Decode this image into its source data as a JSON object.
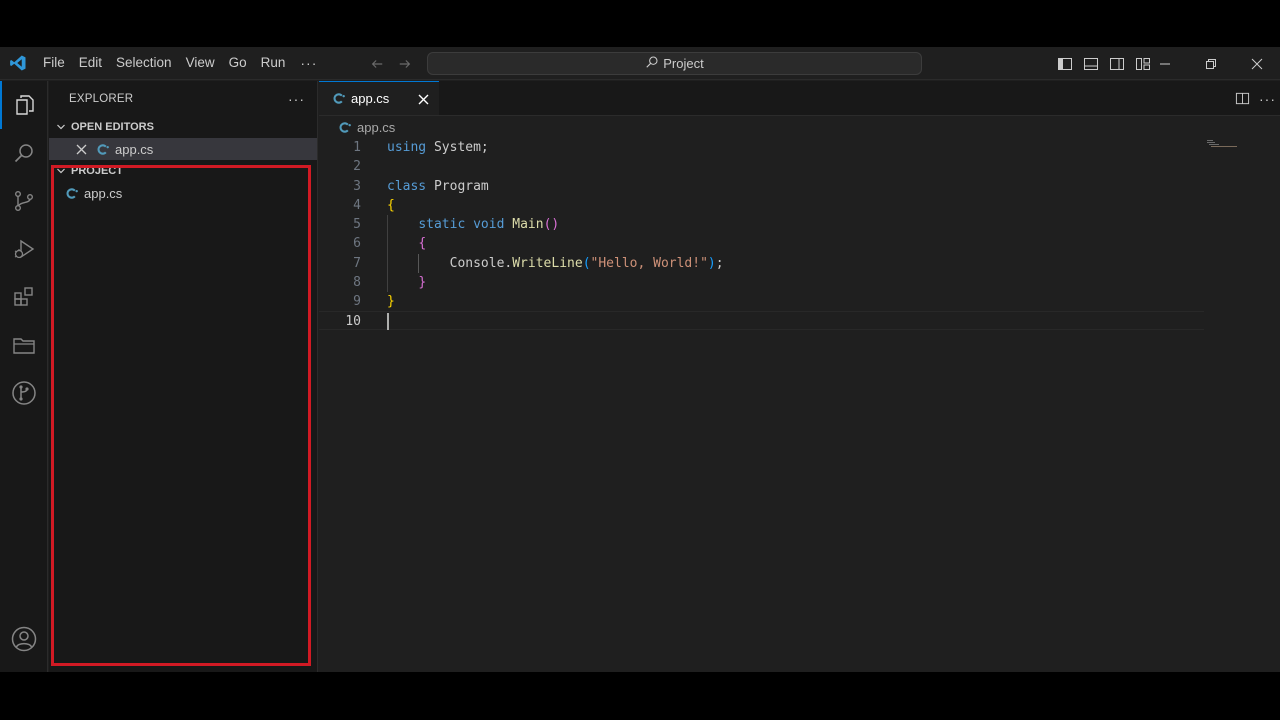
{
  "titlebar": {
    "menu": [
      "File",
      "Edit",
      "Selection",
      "View",
      "Go",
      "Run"
    ],
    "more_label": "···",
    "command_center": "Project"
  },
  "activity_bar": {
    "items": [
      "explorer-icon",
      "search-icon",
      "source-control-icon",
      "run-debug-icon",
      "extensions-icon",
      "remote-explorer-icon",
      "git-graph-icon"
    ],
    "bottom": [
      "accounts-icon"
    ]
  },
  "sidebar": {
    "title": "EXPLORER",
    "more_label": "···",
    "open_editors": {
      "label": "OPEN EDITORS",
      "files": [
        "app.cs"
      ]
    },
    "project": {
      "label": "PROJECT",
      "files": [
        "app.cs"
      ]
    }
  },
  "editor": {
    "tab": {
      "label": "app.cs"
    },
    "breadcrumb": "app.cs",
    "lines": [
      {
        "n": "1",
        "tokens": [
          [
            "kw",
            "using"
          ],
          [
            "ty",
            " System;"
          ]
        ]
      },
      {
        "n": "2",
        "tokens": []
      },
      {
        "n": "3",
        "tokens": [
          [
            "kw",
            "class"
          ],
          [
            "ty",
            " Program"
          ]
        ]
      },
      {
        "n": "4",
        "tokens": [
          [
            "br1",
            "{"
          ]
        ]
      },
      {
        "n": "5",
        "tokens": [
          [
            "ty",
            "    "
          ],
          [
            "kw",
            "static"
          ],
          [
            "ty",
            " "
          ],
          [
            "kw",
            "void"
          ],
          [
            "ty",
            " "
          ],
          [
            "fn",
            "Main"
          ],
          [
            "br2",
            "()"
          ]
        ]
      },
      {
        "n": "6",
        "tokens": [
          [
            "ty",
            "    "
          ],
          [
            "br2",
            "{"
          ]
        ]
      },
      {
        "n": "7",
        "tokens": [
          [
            "ty",
            "        Console."
          ],
          [
            "fn",
            "WriteLine"
          ],
          [
            "br3",
            "("
          ],
          [
            "str",
            "\"Hello, World!\""
          ],
          [
            "br3",
            ")"
          ],
          [
            "ty",
            ";"
          ]
        ]
      },
      {
        "n": "8",
        "tokens": [
          [
            "ty",
            "    "
          ],
          [
            "br2",
            "}"
          ]
        ]
      },
      {
        "n": "9",
        "tokens": [
          [
            "br1",
            "}"
          ]
        ]
      },
      {
        "n": "10",
        "tokens": []
      }
    ],
    "current_line": "10"
  },
  "colors": {
    "accent": "#0078d4",
    "highlight_box": "#d11a24",
    "csharp_icon": "#519aba"
  }
}
